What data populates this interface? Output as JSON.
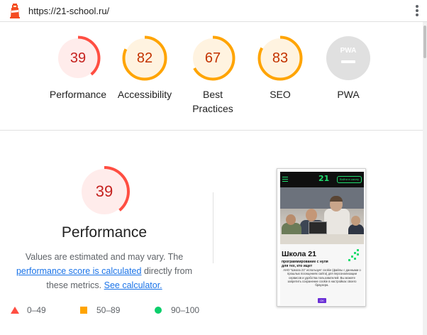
{
  "topbar": {
    "url": "https://21-school.ru/"
  },
  "colors": {
    "fail": "#ff4e42",
    "fail_text": "#c5221f",
    "average": "#ffa400",
    "average_text": "#c33300",
    "pass": "#0cce6b",
    "na": "#e0e0e0",
    "link": "#1a73e8"
  },
  "summary": {
    "categories": [
      {
        "label": "Performance",
        "score": "39",
        "score_value": 39,
        "rating": "fail"
      },
      {
        "label": "Accessibility",
        "score": "82",
        "score_value": 82,
        "rating": "average"
      },
      {
        "label": "Best Practices",
        "score": "67",
        "score_value": 67,
        "rating": "average"
      },
      {
        "label": "SEO",
        "score": "83",
        "score_value": 83,
        "rating": "average"
      },
      {
        "label": "PWA",
        "score": "",
        "rating": "na",
        "icon": "pwa-badge-icon"
      }
    ]
  },
  "performance": {
    "score": "39",
    "score_value": 39,
    "title": "Performance",
    "desc_prefix": "Values are estimated and may vary. The",
    "desc_link": "performance score is calculated",
    "desc_middle": "directly from these metrics.",
    "calc_link": "See calculator.",
    "legend": [
      {
        "range": "0–49",
        "icon": "red-triangle-icon"
      },
      {
        "range": "50–89",
        "icon": "orange-square-icon"
      },
      {
        "range": "90–100",
        "icon": "green-circle-icon"
      }
    ]
  },
  "screenshot": {
    "logo": "21",
    "login_label": "Войти в школу",
    "title": "Школа 21",
    "subtitle": "программирование с нуля для тех, кто ищет",
    "cookie_text": "АНО \"Школа 21\" использует cookie (файлы с данными о прошлых посещениях сайта) для персонализации сервисов и удобства пользователей. Вы можете запретить сохранение cookie в настройках своего браузера.",
    "ok_label": "OK"
  }
}
